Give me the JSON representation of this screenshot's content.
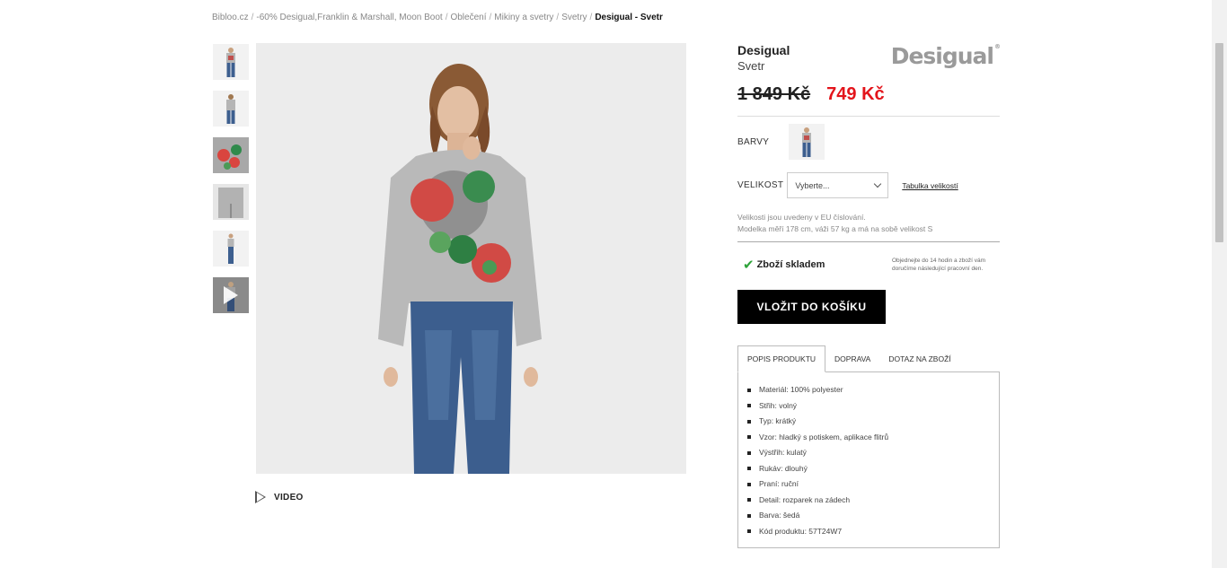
{
  "breadcrumb": {
    "items": [
      "Bibloo.cz",
      "-60% Desigual,Franklin & Marshall, Moon Boot",
      "Oblečení",
      "Mikiny a svetry",
      "Svetry"
    ],
    "current": "Desigual - Svetr",
    "separator": "/"
  },
  "gallery": {
    "thumbnails": [
      "front-view",
      "back-view",
      "print-detail",
      "back-detail",
      "full-body"
    ],
    "video_thumb_icon": "play-icon",
    "video_label": "VIDEO"
  },
  "product": {
    "brand": "Desigual",
    "name": "Svetr",
    "logo_text": "Desigual",
    "logo_mark": "®",
    "old_price": "1 849 Kč",
    "new_price": "749 Kč",
    "sale_color": "#e3141b"
  },
  "colors": {
    "label": "BARVY"
  },
  "size": {
    "label": "VELIKOST",
    "placeholder": "Vyberte...",
    "table_link": "Tabulka velikostí",
    "note_line1": "Velikosti jsou uvedeny v EU číslování.",
    "note_line2": "Modelka měří 178 cm, váži 57 kg a má na sobě velikost S"
  },
  "stock": {
    "check_icon": "✔",
    "label": "Zboží skladem",
    "delivery_note": "Objednejte do 14 hodin a zboží vám doručíme následující pracovní den."
  },
  "cart": {
    "button_label": "VLOŽIT DO KOŠÍKU"
  },
  "tabs": {
    "items": [
      "POPIS PRODUKTU",
      "DOPRAVA",
      "DOTAZ NA ZBOŽÍ"
    ],
    "active_index": 0
  },
  "description": [
    "Materiál: 100% polyester",
    "Střih: volný",
    "Typ: krátký",
    "Vzor: hladký s potiskem, aplikace flitrů",
    "Výstřih: kulatý",
    "Rukáv: dlouhý",
    "Praní: ruční",
    "Detail: rozparek na zádech",
    "Barva: šedá",
    "Kód produktu: 57T24W7"
  ]
}
